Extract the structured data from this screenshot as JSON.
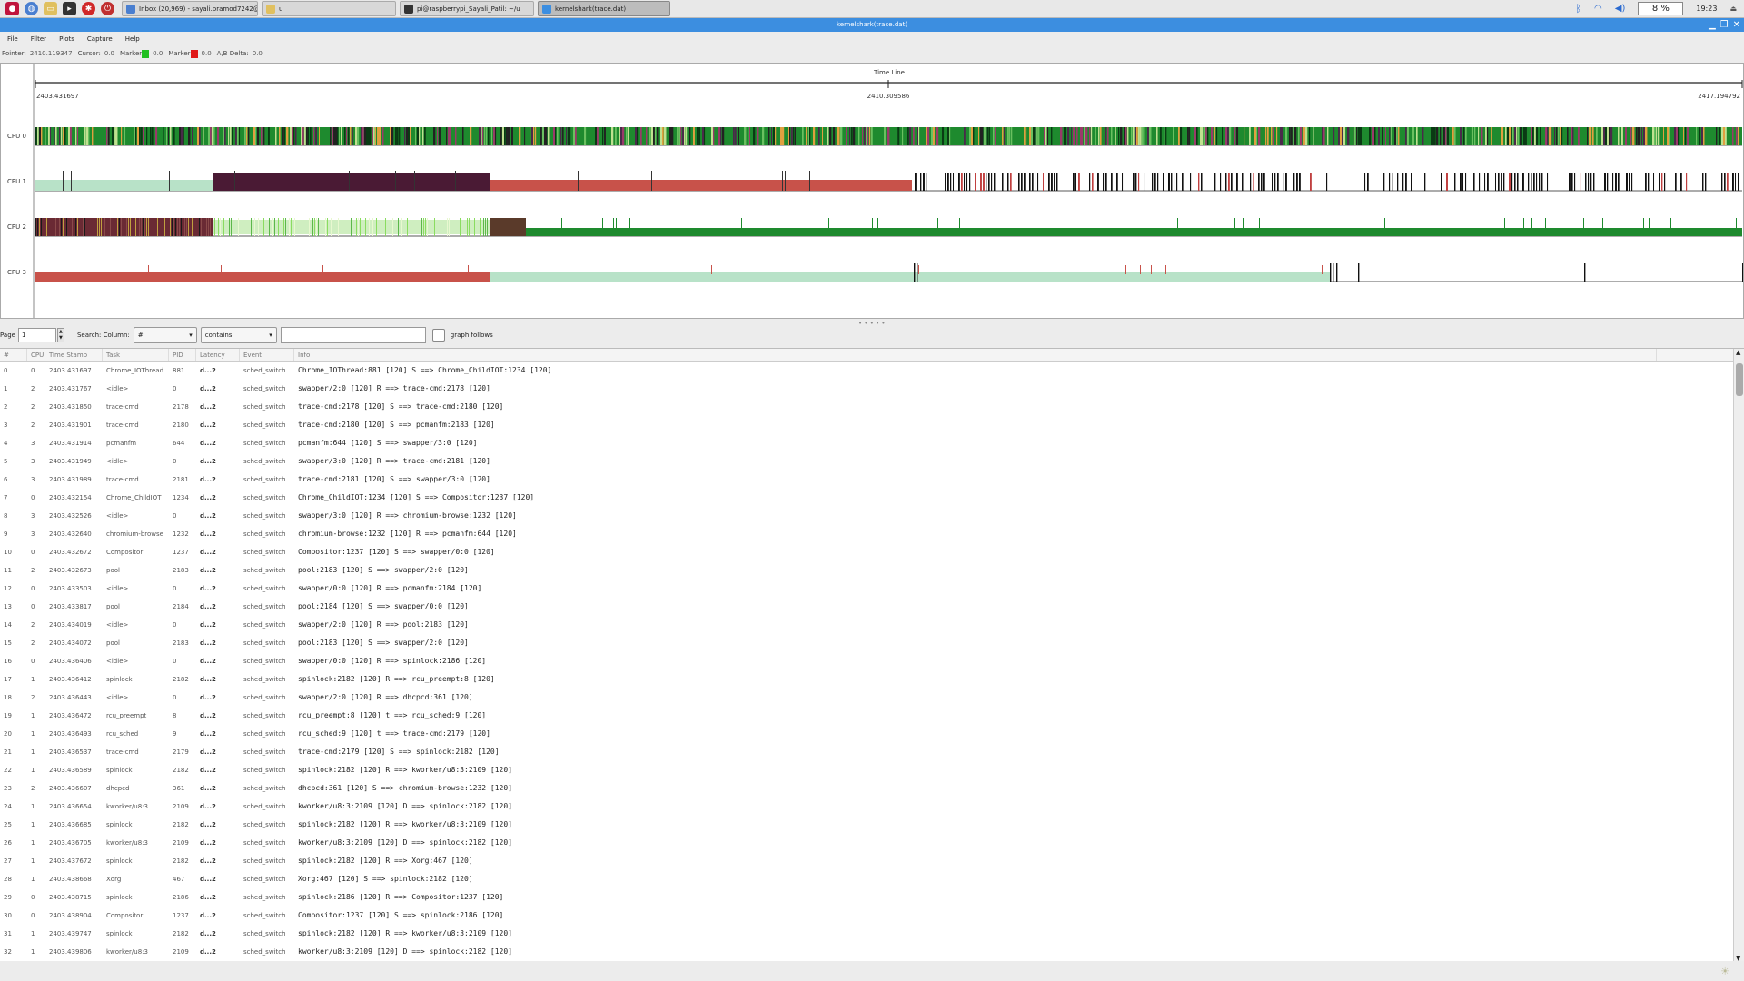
{
  "taskbar": {
    "tasks": [
      {
        "label": "Inbox (20,969) - sayali.pramod7242@...",
        "active": false
      },
      {
        "label": "u",
        "active": false
      },
      {
        "label": "pi@raspberrypi_Sayali_Patil: ~/u",
        "active": false
      },
      {
        "label": "kernelshark(trace.dat)",
        "active": true
      }
    ],
    "cpu_percent": "8 %",
    "clock": "19:23"
  },
  "window": {
    "title": "kernelshark(trace.dat)"
  },
  "menu": [
    "File",
    "Filter",
    "Plots",
    "Capture",
    "Help"
  ],
  "infobar": {
    "pointer_label": "Pointer:",
    "pointer_value": "2410.119347",
    "cursor_label": "Cursor:",
    "cursor_value": "0.0",
    "marker_a_label": "Marker",
    "marker_a_value": "0.0",
    "marker_b_label": "Marker",
    "marker_b_value": "0.0",
    "delta_label": "A,B Delta:",
    "delta_value": "0.0",
    "marker_a_color": "#22c022",
    "marker_b_color": "#e01818"
  },
  "graph": {
    "axis_title": "Time Line",
    "t_start": "2403.431697",
    "t_mid": "2410.309586",
    "t_end": "2417.194792",
    "cpus": [
      "CPU 0",
      "CPU 1",
      "CPU 2",
      "CPU 3"
    ]
  },
  "search": {
    "page_label": "Page",
    "page_value": "1",
    "search_label": "Search: Column:",
    "column_value": "#",
    "mode_value": "contains",
    "graph_follows_label": "graph follows"
  },
  "table": {
    "headers": [
      "#",
      "CPU",
      "Time Stamp",
      "Task",
      "PID",
      "Latency",
      "Event",
      "Info"
    ],
    "rows": [
      [
        "0",
        "0",
        "2403.431697",
        "Chrome_IOThread",
        "881",
        "d...2",
        "sched_switch",
        "Chrome_IOThread:881 [120] S ==> Chrome_ChildIOT:1234 [120]"
      ],
      [
        "1",
        "2",
        "2403.431767",
        "<idle>",
        "0",
        "d...2",
        "sched_switch",
        "swapper/2:0 [120] R ==> trace-cmd:2178 [120]"
      ],
      [
        "2",
        "2",
        "2403.431850",
        "trace-cmd",
        "2178",
        "d...2",
        "sched_switch",
        "trace-cmd:2178 [120] S ==> trace-cmd:2180 [120]"
      ],
      [
        "3",
        "2",
        "2403.431901",
        "trace-cmd",
        "2180",
        "d...2",
        "sched_switch",
        "trace-cmd:2180 [120] S ==> pcmanfm:2183 [120]"
      ],
      [
        "4",
        "3",
        "2403.431914",
        "pcmanfm",
        "644",
        "d...2",
        "sched_switch",
        "pcmanfm:644 [120] S ==> swapper/3:0 [120]"
      ],
      [
        "5",
        "3",
        "2403.431949",
        "<idle>",
        "0",
        "d...2",
        "sched_switch",
        "swapper/3:0 [120] R ==> trace-cmd:2181 [120]"
      ],
      [
        "6",
        "3",
        "2403.431989",
        "trace-cmd",
        "2181",
        "d...2",
        "sched_switch",
        "trace-cmd:2181 [120] S ==> swapper/3:0 [120]"
      ],
      [
        "7",
        "0",
        "2403.432154",
        "Chrome_ChildIOT",
        "1234",
        "d...2",
        "sched_switch",
        "Chrome_ChildIOT:1234 [120] S ==> Compositor:1237 [120]"
      ],
      [
        "8",
        "3",
        "2403.432526",
        "<idle>",
        "0",
        "d...2",
        "sched_switch",
        "swapper/3:0 [120] R ==> chromium-browse:1232 [120]"
      ],
      [
        "9",
        "3",
        "2403.432640",
        "chromium-browse",
        "1232",
        "d...2",
        "sched_switch",
        "chromium-browse:1232 [120] R ==> pcmanfm:644 [120]"
      ],
      [
        "10",
        "0",
        "2403.432672",
        "Compositor",
        "1237",
        "d...2",
        "sched_switch",
        "Compositor:1237 [120] S ==> swapper/0:0 [120]"
      ],
      [
        "11",
        "2",
        "2403.432673",
        "pool",
        "2183",
        "d...2",
        "sched_switch",
        "pool:2183 [120] S ==> swapper/2:0 [120]"
      ],
      [
        "12",
        "0",
        "2403.433503",
        "<idle>",
        "0",
        "d...2",
        "sched_switch",
        "swapper/0:0 [120] R ==> pcmanfm:2184 [120]"
      ],
      [
        "13",
        "0",
        "2403.433817",
        "pool",
        "2184",
        "d...2",
        "sched_switch",
        "pool:2184 [120] S ==> swapper/0:0 [120]"
      ],
      [
        "14",
        "2",
        "2403.434019",
        "<idle>",
        "0",
        "d...2",
        "sched_switch",
        "swapper/2:0 [120] R ==> pool:2183 [120]"
      ],
      [
        "15",
        "2",
        "2403.434072",
        "pool",
        "2183",
        "d...2",
        "sched_switch",
        "pool:2183 [120] S ==> swapper/2:0 [120]"
      ],
      [
        "16",
        "0",
        "2403.436406",
        "<idle>",
        "0",
        "d...2",
        "sched_switch",
        "swapper/0:0 [120] R ==> spinlock:2186 [120]"
      ],
      [
        "17",
        "1",
        "2403.436412",
        "spinlock",
        "2182",
        "d...2",
        "sched_switch",
        "spinlock:2182 [120] R ==> rcu_preempt:8 [120]"
      ],
      [
        "18",
        "2",
        "2403.436443",
        "<idle>",
        "0",
        "d...2",
        "sched_switch",
        "swapper/2:0 [120] R ==> dhcpcd:361 [120]"
      ],
      [
        "19",
        "1",
        "2403.436472",
        "rcu_preempt",
        "8",
        "d...2",
        "sched_switch",
        "rcu_preempt:8 [120] t ==> rcu_sched:9 [120]"
      ],
      [
        "20",
        "1",
        "2403.436493",
        "rcu_sched",
        "9",
        "d...2",
        "sched_switch",
        "rcu_sched:9 [120] t ==> trace-cmd:2179 [120]"
      ],
      [
        "21",
        "1",
        "2403.436537",
        "trace-cmd",
        "2179",
        "d...2",
        "sched_switch",
        "trace-cmd:2179 [120] S ==> spinlock:2182 [120]"
      ],
      [
        "22",
        "1",
        "2403.436589",
        "spinlock",
        "2182",
        "d...2",
        "sched_switch",
        "spinlock:2182 [120] R ==> kworker/u8:3:2109 [120]"
      ],
      [
        "23",
        "2",
        "2403.436607",
        "dhcpcd",
        "361",
        "d...2",
        "sched_switch",
        "dhcpcd:361 [120] S ==> chromium-browse:1232 [120]"
      ],
      [
        "24",
        "1",
        "2403.436654",
        "kworker/u8:3",
        "2109",
        "d...2",
        "sched_switch",
        "kworker/u8:3:2109 [120] D ==> spinlock:2182 [120]"
      ],
      [
        "25",
        "1",
        "2403.436685",
        "spinlock",
        "2182",
        "d...2",
        "sched_switch",
        "spinlock:2182 [120] R ==> kworker/u8:3:2109 [120]"
      ],
      [
        "26",
        "1",
        "2403.436705",
        "kworker/u8:3",
        "2109",
        "d...2",
        "sched_switch",
        "kworker/u8:3:2109 [120] D ==> spinlock:2182 [120]"
      ],
      [
        "27",
        "1",
        "2403.437672",
        "spinlock",
        "2182",
        "d...2",
        "sched_switch",
        "spinlock:2182 [120] R ==> Xorg:467 [120]"
      ],
      [
        "28",
        "1",
        "2403.438668",
        "Xorg",
        "467",
        "d...2",
        "sched_switch",
        "Xorg:467 [120] S ==> spinlock:2182 [120]"
      ],
      [
        "29",
        "0",
        "2403.438715",
        "spinlock",
        "2186",
        "d...2",
        "sched_switch",
        "spinlock:2186 [120] R ==> Compositor:1237 [120]"
      ],
      [
        "30",
        "0",
        "2403.438904",
        "Compositor",
        "1237",
        "d...2",
        "sched_switch",
        "Compositor:1237 [120] S ==> spinlock:2186 [120]"
      ],
      [
        "31",
        "1",
        "2403.439747",
        "spinlock",
        "2182",
        "d...2",
        "sched_switch",
        "spinlock:2182 [120] R ==> kworker/u8:3:2109 [120]"
      ],
      [
        "32",
        "1",
        "2403.439806",
        "kworker/u8:3",
        "2109",
        "d...2",
        "sched_switch",
        "kworker/u8:3:2109 [120] D ==> spinlock:2182 [120]"
      ]
    ]
  }
}
